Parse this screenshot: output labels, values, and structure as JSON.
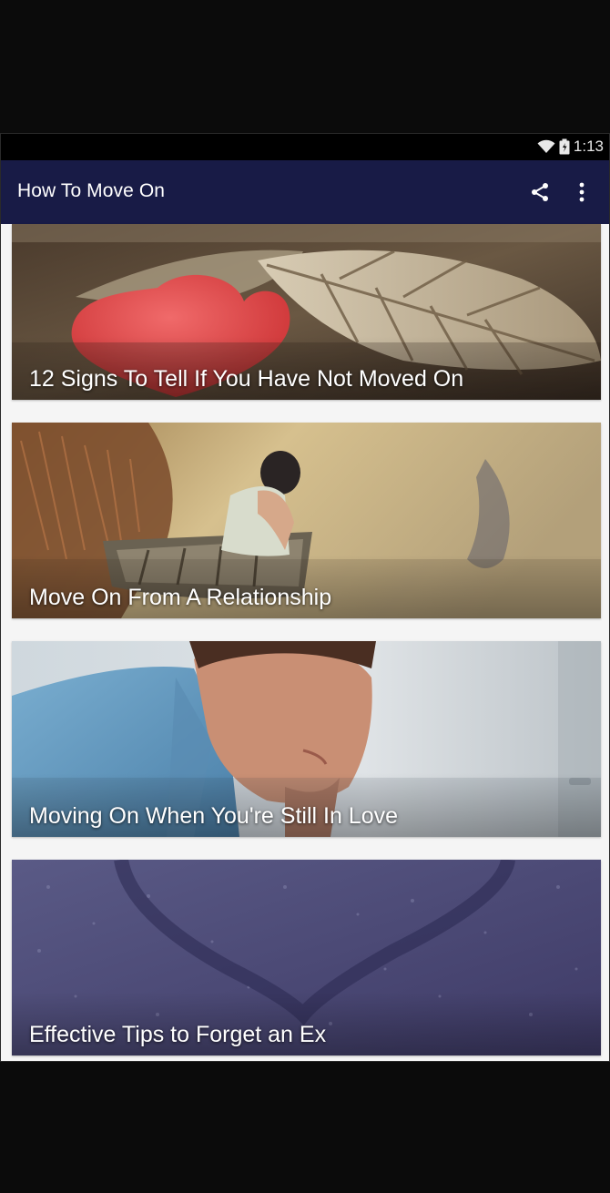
{
  "status_bar": {
    "time": "1:13",
    "icons": [
      "wifi-icon",
      "battery-icon"
    ]
  },
  "app_bar": {
    "title": "How To Move On",
    "actions": [
      "share-icon",
      "more-vert-icon"
    ]
  },
  "articles": [
    {
      "title": "12 Signs To Tell If You Have Not Moved On",
      "image": "red-heart-on-dry-leaf"
    },
    {
      "title": "Move On From A Relationship",
      "image": "woman-sitting-on-boat"
    },
    {
      "title": "Moving On When You're Still In Love",
      "image": "sad-man-thinking"
    },
    {
      "title": "Effective Tips to Forget an Ex",
      "image": "heart-drawn-on-wet-glass"
    }
  ],
  "colors": {
    "app_bar": "#181b46",
    "background": "#f5f5f5",
    "status_bar": "#000000"
  }
}
